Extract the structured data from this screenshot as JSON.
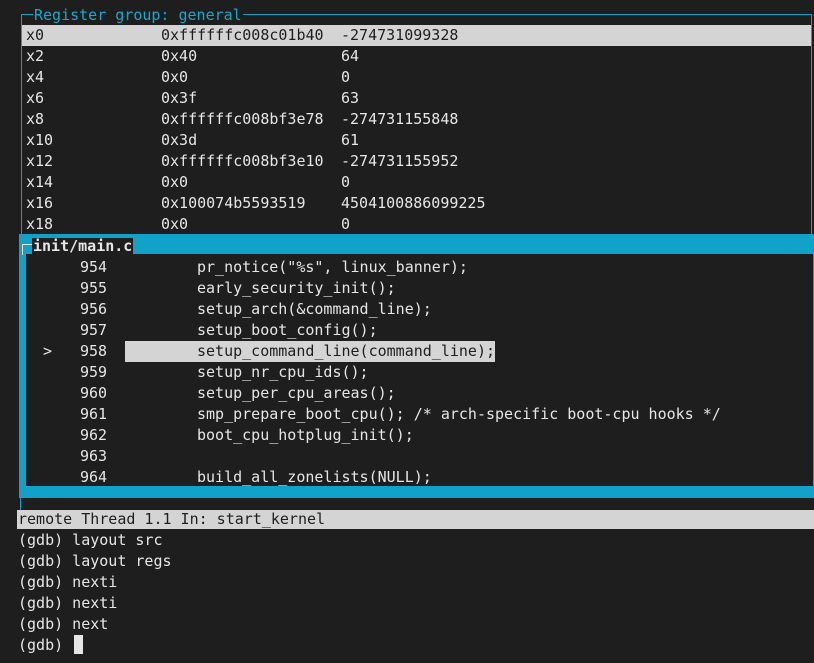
{
  "colors": {
    "background": "#1e1e1e",
    "border_accent": "#12a1c9",
    "highlight": "#d4d4d4",
    "text": "#e6e6e6"
  },
  "register_window": {
    "title": "Register group: general",
    "rows": [
      {
        "name": "x0",
        "hex": "0xffffffc008c01b40",
        "dec": "-274731099328",
        "selected": true
      },
      {
        "name": "x2",
        "hex": "0x40",
        "dec": "64"
      },
      {
        "name": "x4",
        "hex": "0x0",
        "dec": "0"
      },
      {
        "name": "x6",
        "hex": "0x3f",
        "dec": "63"
      },
      {
        "name": "x8",
        "hex": "0xffffffc008bf3e78",
        "dec": "-274731155848"
      },
      {
        "name": "x10",
        "hex": "0x3d",
        "dec": "61"
      },
      {
        "name": "x12",
        "hex": "0xffffffc008bf3e10",
        "dec": "-274731155952"
      },
      {
        "name": "x14",
        "hex": "0x0",
        "dec": "0"
      },
      {
        "name": "x16",
        "hex": "0x100074b5593519",
        "dec": "4504100886099225"
      },
      {
        "name": "x18",
        "hex": "0x0",
        "dec": "0"
      }
    ]
  },
  "source_window": {
    "title": "init/main.c",
    "current_marker": ">",
    "lines": [
      {
        "num": "954",
        "code": "pr_notice(\"%s\", linux_banner);"
      },
      {
        "num": "955",
        "code": "early_security_init();"
      },
      {
        "num": "956",
        "code": "setup_arch(&command_line);"
      },
      {
        "num": "957",
        "code": "setup_boot_config();"
      },
      {
        "num": "958",
        "code": "setup_command_line(command_line);",
        "current": true
      },
      {
        "num": "959",
        "code": "setup_nr_cpu_ids();"
      },
      {
        "num": "960",
        "code": "setup_per_cpu_areas();"
      },
      {
        "num": "961",
        "code": "smp_prepare_boot_cpu(); /* arch-specific boot-cpu hooks */"
      },
      {
        "num": "962",
        "code": "boot_cpu_hotplug_init();"
      },
      {
        "num": "963",
        "code": ""
      },
      {
        "num": "964",
        "code": "build_all_zonelists(NULL);"
      }
    ]
  },
  "status_bar": {
    "text": "remote Thread 1.1 In: start_kernel"
  },
  "command_window": {
    "history": [
      "(gdb) layout src",
      "(gdb) layout regs",
      "(gdb) nexti",
      "(gdb) nexti",
      "(gdb) next"
    ],
    "prompt": "(gdb)"
  }
}
